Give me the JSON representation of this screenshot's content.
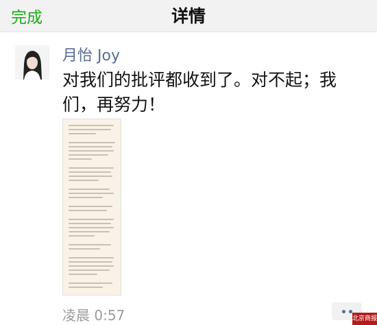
{
  "navbar": {
    "done_label": "完成",
    "title": "详情"
  },
  "post": {
    "nickname": "月怡 Joy",
    "text": "对我们的批评都收到了。对不起；我们，再努力！",
    "timestamp": "凌晨 0:57"
  },
  "icons": {
    "more": "more-dots-icon",
    "avatar": "avatar-image"
  },
  "watermark": {
    "text": "北京商报"
  },
  "colors": {
    "accent_green": "#1aad19",
    "link_blue": "#576b95",
    "watermark_red": "#b51b1b"
  }
}
